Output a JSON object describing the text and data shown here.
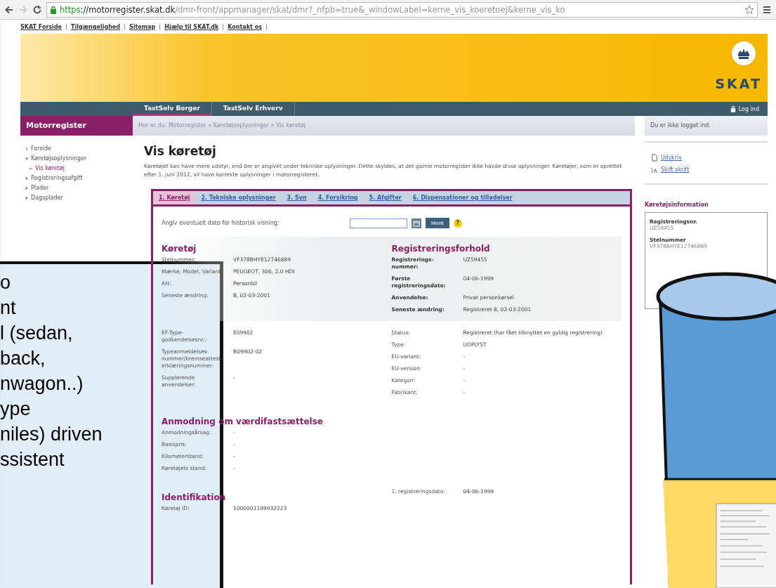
{
  "browser": {
    "url": {
      "scheme": "https",
      "host": "://motorregister.skat.dk",
      "path": "/dmr-front/appmanager/skat/dmr?_nfpb=true&_windowLabel=kerne_vis_koeretoej&kerne_vis_ko"
    }
  },
  "top_links": [
    "SKAT Forside",
    "Tilgængelighed",
    "Sitemap",
    "Hjælp til SKAT.dk",
    "Kontakt os"
  ],
  "logo": {
    "text": "SKAT"
  },
  "nav_tabs": [
    {
      "label": "TastSelv Borger",
      "selected": true
    },
    {
      "label": "TastSelv Erhverv",
      "selected": false
    }
  ],
  "login": "Log ind",
  "sidebar": {
    "title": "Motorregister",
    "items": [
      {
        "label": "Forside",
        "selected": false
      },
      {
        "label": "Køretøjsoplysninger",
        "selected": false,
        "expanded": true,
        "children": [
          {
            "label": "Vis køretøj",
            "selected": true
          }
        ]
      },
      {
        "label": "Registreringsafgift",
        "selected": false,
        "expanded": false
      },
      {
        "label": "Plader",
        "selected": false,
        "expanded": false
      },
      {
        "label": "Dagsplader",
        "selected": false,
        "expanded": false
      }
    ]
  },
  "breadcrumb": "Her er du: Motorregister » Køretøjsoplysninger » Vis køretøj",
  "login_status": "Du er ikke logget ind.",
  "page_title": "Vis køretøj",
  "intro": "Køretøjet kan have mere udstyr, end der er angivet under tekniske oplysninger. Dette skyldes, at det gamle motorregister ikke havde disse oplysninger. Køretøjer, som er oprettet efter 1. juni 2012, vil have korrekte oplysninger i motorregisteret.",
  "tabs": [
    {
      "label": "1. Køretøj",
      "selected": true
    },
    {
      "label": "2. Tekniske oplysninger",
      "selected": false
    },
    {
      "label": "3. Syn",
      "selected": false
    },
    {
      "label": "4. Forsikring",
      "selected": false
    },
    {
      "label": "5. Afgifter",
      "selected": false
    },
    {
      "label": "6. Dispensationer og tilladelser",
      "selected": false
    }
  ],
  "history": {
    "label": "Angiv eventuelt dato for historisk visning:",
    "button": "Hent",
    "help": "?"
  },
  "blocks": [
    {
      "kind": "shaded",
      "columns": [
        {
          "title": "Køretøj",
          "fields": [
            {
              "label": "Stelnummer:",
              "value": "VF378BHYE12746889"
            },
            {
              "label": "Mærke, Model, Variant:",
              "value": "PEUGEOT, 306, 2.0 HDI"
            },
            {
              "label": "Art:",
              "value": "Personbil"
            },
            {
              "label": "Seneste ændring:",
              "value": "8, 02-03-2001"
            }
          ]
        },
        {
          "title": "Registreringsforhold",
          "bold_labels": true,
          "fields": [
            {
              "label": "Registrerings-nummer:",
              "value": "UZ59455"
            },
            {
              "label": "Første registreringsdato:",
              "value": "04-06-1999"
            },
            {
              "label": "Anvendelse:",
              "value": "Privat personkørsel"
            },
            {
              "label": "Seneste ændring:",
              "value": "Registreret 8, 02-03-2001"
            }
          ]
        }
      ]
    },
    {
      "kind": "plain",
      "columns": [
        {
          "fields": [
            {
              "label": "EF-Type-godkendelsesnr.:",
              "value": "E09902"
            },
            {
              "label": "Typeanmeldelses-nummer/bremseattest-erklæringsnummer:",
              "value": "B09902-02"
            },
            {
              "label": "Supplerende anvendelser:",
              "value": "-"
            }
          ]
        },
        {
          "fields": [
            {
              "label": "Status:",
              "value": "Registreret (har fået tilknyttet en gyldig registrering)"
            },
            {
              "label": "Type:",
              "value": "UOPLYST"
            },
            {
              "label": "EU-variant:",
              "value": "-"
            },
            {
              "label": "EU-version:",
              "value": "-"
            },
            {
              "label": "Kategori:",
              "value": "-"
            },
            {
              "label": "Fabrikant:",
              "value": "-"
            }
          ]
        }
      ]
    },
    {
      "kind": "plain",
      "columns": [
        {
          "title": "Anmodning om værdifastsættelse",
          "fields": [
            {
              "label": "Anmodningsårsag:",
              "value": "-"
            },
            {
              "label": "Basispris:",
              "value": "-"
            },
            {
              "label": "Kilometerstand:",
              "value": "-"
            },
            {
              "label": "Køretøjets stand:",
              "value": "-"
            }
          ]
        }
      ]
    },
    {
      "kind": "plain",
      "columns": [
        {
          "title": "Identifikation",
          "fields": [
            {
              "label": "Køretøj ID:",
              "value": "1000001199932223"
            }
          ]
        },
        {
          "fields": [
            {
              "label": "1. registreringsdato:",
              "value": "04-06-1999"
            }
          ]
        }
      ]
    }
  ],
  "right_panel": {
    "links": [
      {
        "kind": "print",
        "label": "Udskriv"
      },
      {
        "kind": "font",
        "label": "Skift skrift"
      }
    ],
    "info_title": "Køretøjsinformation",
    "info": [
      {
        "label": "Registreringsnr.",
        "value": "UZ59455"
      },
      {
        "label": "Stelnummer",
        "value": "VF378BHYE12746889"
      }
    ]
  },
  "annotation": {
    "lines": [
      "o",
      "nt",
      "l (sedan,",
      "back,",
      "nwagon..)",
      "ype",
      "niles) driven",
      "ssistent"
    ]
  }
}
